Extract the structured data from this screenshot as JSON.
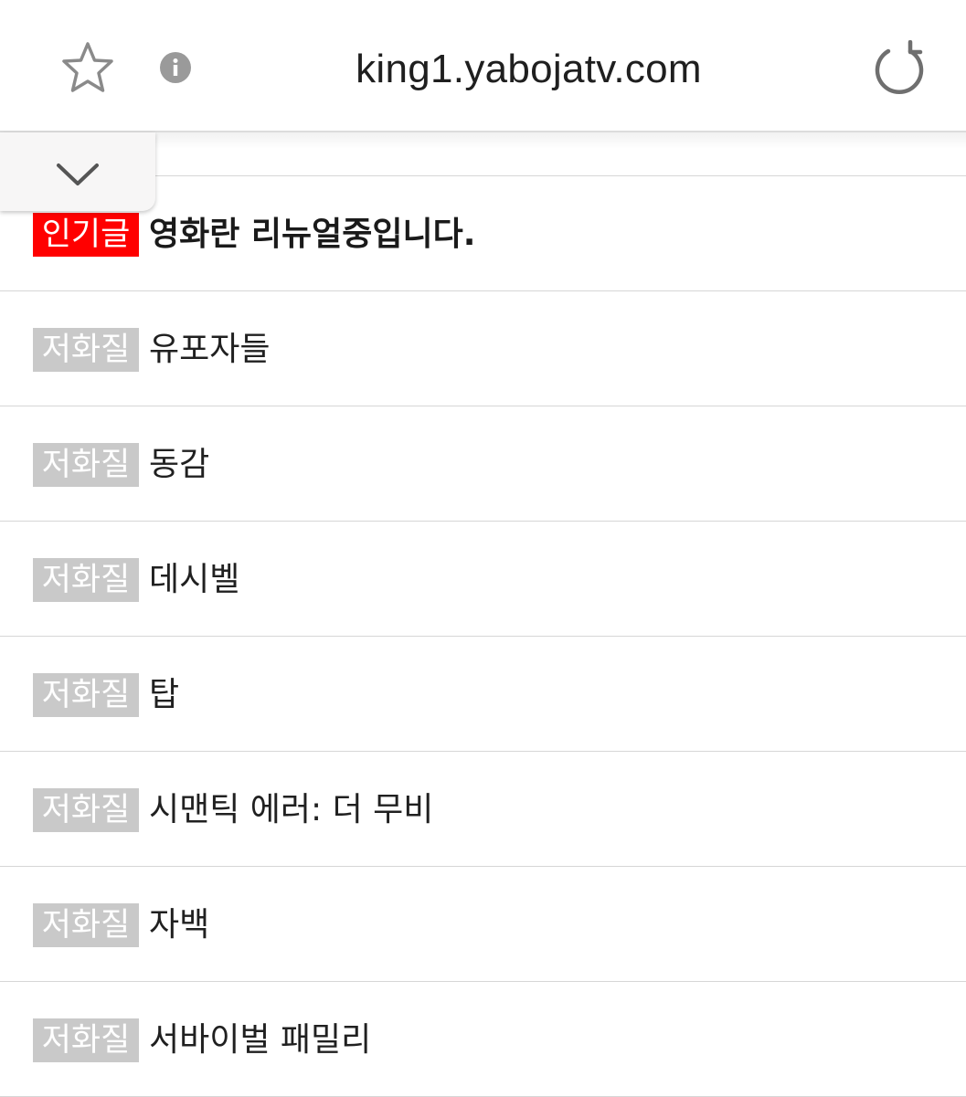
{
  "browser": {
    "url": "king1.yabojatv.com",
    "icons": {
      "bookmark": "star-icon",
      "site_info": "info-icon",
      "reload": "reload-icon",
      "collapse": "chevron-down-icon"
    }
  },
  "colors": {
    "popular_badge": "#ff0000",
    "low_quality_badge": "#c9c9c9",
    "divider": "#d6d6d6"
  },
  "posts": [
    {
      "badge": "인기글",
      "badge_type": "popular",
      "title": "영화란 리뉴얼중입니다.",
      "bold": true
    },
    {
      "badge": "저화질",
      "badge_type": "lowq",
      "title": "유포자들",
      "bold": false
    },
    {
      "badge": "저화질",
      "badge_type": "lowq",
      "title": "동감",
      "bold": false
    },
    {
      "badge": "저화질",
      "badge_type": "lowq",
      "title": "데시벨",
      "bold": false
    },
    {
      "badge": "저화질",
      "badge_type": "lowq",
      "title": "탑",
      "bold": false
    },
    {
      "badge": "저화질",
      "badge_type": "lowq",
      "title": "시맨틱 에러: 더 무비",
      "bold": false
    },
    {
      "badge": "저화질",
      "badge_type": "lowq",
      "title": "자백",
      "bold": false
    },
    {
      "badge": "저화질",
      "badge_type": "lowq",
      "title": "서바이벌 패밀리",
      "bold": false
    }
  ]
}
